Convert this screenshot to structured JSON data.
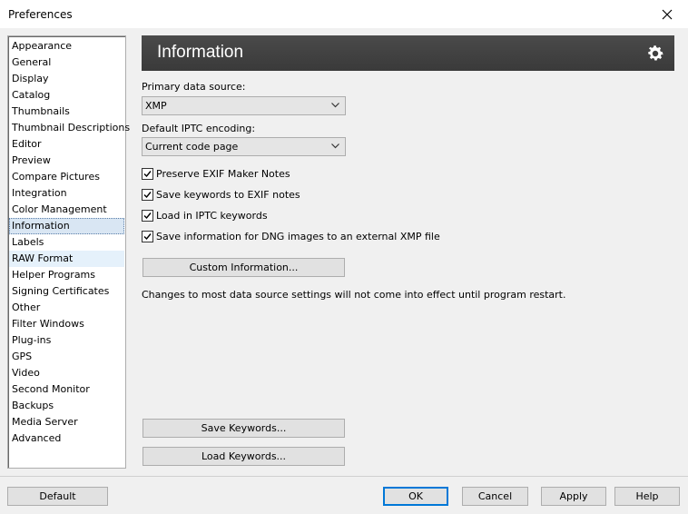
{
  "window": {
    "title": "Preferences"
  },
  "sidebar": {
    "items": [
      "Appearance",
      "General",
      "Display",
      "Catalog",
      "Thumbnails",
      "Thumbnail Descriptions",
      "Editor",
      "Preview",
      "Compare Pictures",
      "Integration",
      "Color Management",
      "Information",
      "Labels",
      "RAW Format",
      "Helper Programs",
      "Signing Certificates",
      "Other",
      "Filter Windows",
      "Plug-ins",
      "GPS",
      "Video",
      "Second Monitor",
      "Backups",
      "Media Server",
      "Advanced"
    ],
    "selected": "Information",
    "hovered": "RAW Format"
  },
  "panel": {
    "title": "Information",
    "primary_source_label": "Primary data source:",
    "primary_source_value": "XMP",
    "iptc_label": "Default IPTC encoding:",
    "iptc_value": "Current code page",
    "checkboxes": [
      {
        "label": "Preserve EXIF Maker Notes",
        "checked": true
      },
      {
        "label": "Save keywords to EXIF notes",
        "checked": true
      },
      {
        "label": "Load in IPTC keywords",
        "checked": true
      },
      {
        "label": "Save information for DNG images to an external XMP file",
        "checked": true
      }
    ],
    "custom_info_button": "Custom Information...",
    "note": "Changes to most data source settings will not come into effect until program restart.",
    "save_keywords_button": "Save Keywords...",
    "load_keywords_button": "Load Keywords..."
  },
  "footer": {
    "default_button": "Default",
    "ok_button": "OK",
    "cancel_button": "Cancel",
    "apply_button": "Apply",
    "help_button": "Help"
  }
}
